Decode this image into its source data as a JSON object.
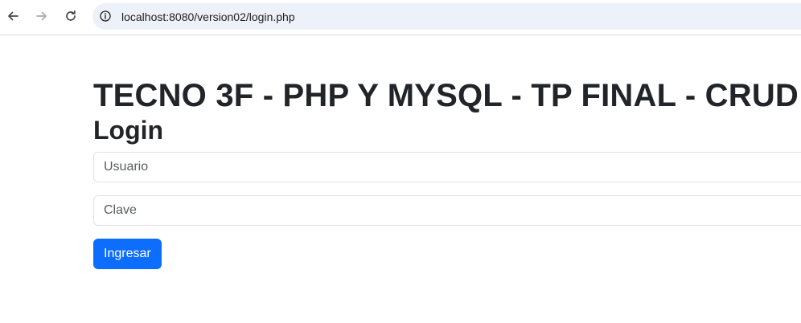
{
  "browser": {
    "url": "localhost:8080/version02/login.php",
    "icons": {
      "back": "arrow-left-icon",
      "forward": "arrow-right-icon",
      "reload": "reload-icon",
      "site_info": "info-icon"
    }
  },
  "page": {
    "heading": "TECNO 3F - PHP Y MYSQL - TP FINAL - CRUD",
    "section_title": "Login"
  },
  "form": {
    "usuario": {
      "placeholder": "Usuario",
      "value": ""
    },
    "clave": {
      "placeholder": "Clave",
      "value": ""
    },
    "submit_label": "Ingresar"
  },
  "colors": {
    "primary_button": "#0d6efd",
    "omnibox_bg": "#edf1f9",
    "text": "#212529"
  }
}
